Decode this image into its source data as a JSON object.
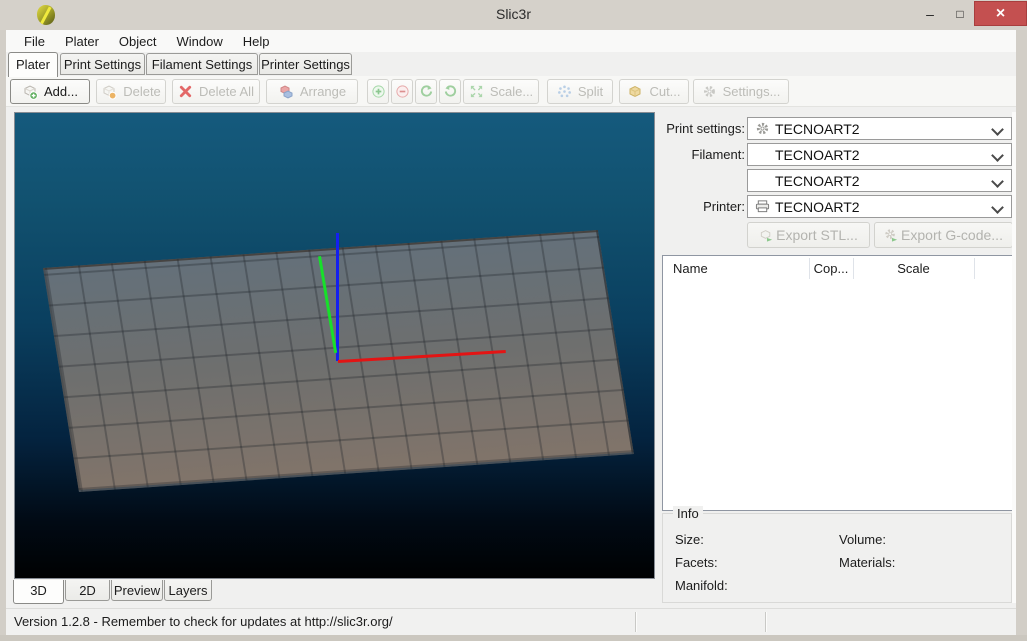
{
  "window": {
    "title": "Slic3r",
    "status_text": "Version 1.2.8 - Remember to check for updates at http://slic3r.org/"
  },
  "icons": {
    "app_logo": "slic3r-olive-leaf",
    "minimize_glyph": "–",
    "maximize_glyph": "□",
    "close_glyph": "×",
    "add": "cube-plus-badge",
    "delete": "cube-minus-badge",
    "delete_all": "red-x",
    "arrange": "two-cubes",
    "increase": "green-plus-circle",
    "decrease": "red-minus-circle",
    "rotate_ccw": "ccw-arrow",
    "rotate_cw": "cw-arrow",
    "scale": "four-diagonal-arrows",
    "split": "dotted-circle",
    "cut": "yellow-cube",
    "settings": "gear",
    "print_settings_combo": "gear",
    "printer_combo": "printer",
    "export": "cube-green-arrow",
    "dropdown": "chevron-down"
  },
  "colors": {
    "close_button": "#c45050",
    "axis_x": "#e31414",
    "axis_y": "#17e02a",
    "axis_z": "#1420f0",
    "bed_gray": "#6e6f6e",
    "viewport_top": "#155a7d",
    "viewport_bottom": "#000102"
  },
  "menu": {
    "items": [
      "File",
      "Plater",
      "Object",
      "Window",
      "Help"
    ]
  },
  "tabs": {
    "active": "Plater",
    "items": [
      "Plater",
      "Print Settings",
      "Filament Settings",
      "Printer Settings"
    ]
  },
  "toolbar": {
    "add": "Add...",
    "delete": "Delete",
    "delete_all": "Delete All",
    "arrange": "Arrange",
    "scale": "Scale...",
    "split": "Split",
    "cut": "Cut...",
    "settings": "Settings..."
  },
  "sidebar": {
    "print_settings_label": "Print settings:",
    "print_settings_value": "TECNOART2",
    "filament_label": "Filament:",
    "filament_value_1": "TECNOART2",
    "filament_value_2": "TECNOART2",
    "printer_label": "Printer:",
    "printer_value": "TECNOART2",
    "export_stl": "Export STL...",
    "export_gcode": "Export G-code...",
    "table": {
      "columns": [
        "Name",
        "Cop...",
        "Scale"
      ],
      "rows": []
    },
    "info": {
      "legend": "Info",
      "size": "Size:",
      "volume": "Volume:",
      "facets": "Facets:",
      "materials": "Materials:",
      "manifold": "Manifold:"
    }
  },
  "view_tabs": {
    "active": "3D",
    "items": [
      "3D",
      "2D",
      "Preview",
      "Layers"
    ]
  }
}
